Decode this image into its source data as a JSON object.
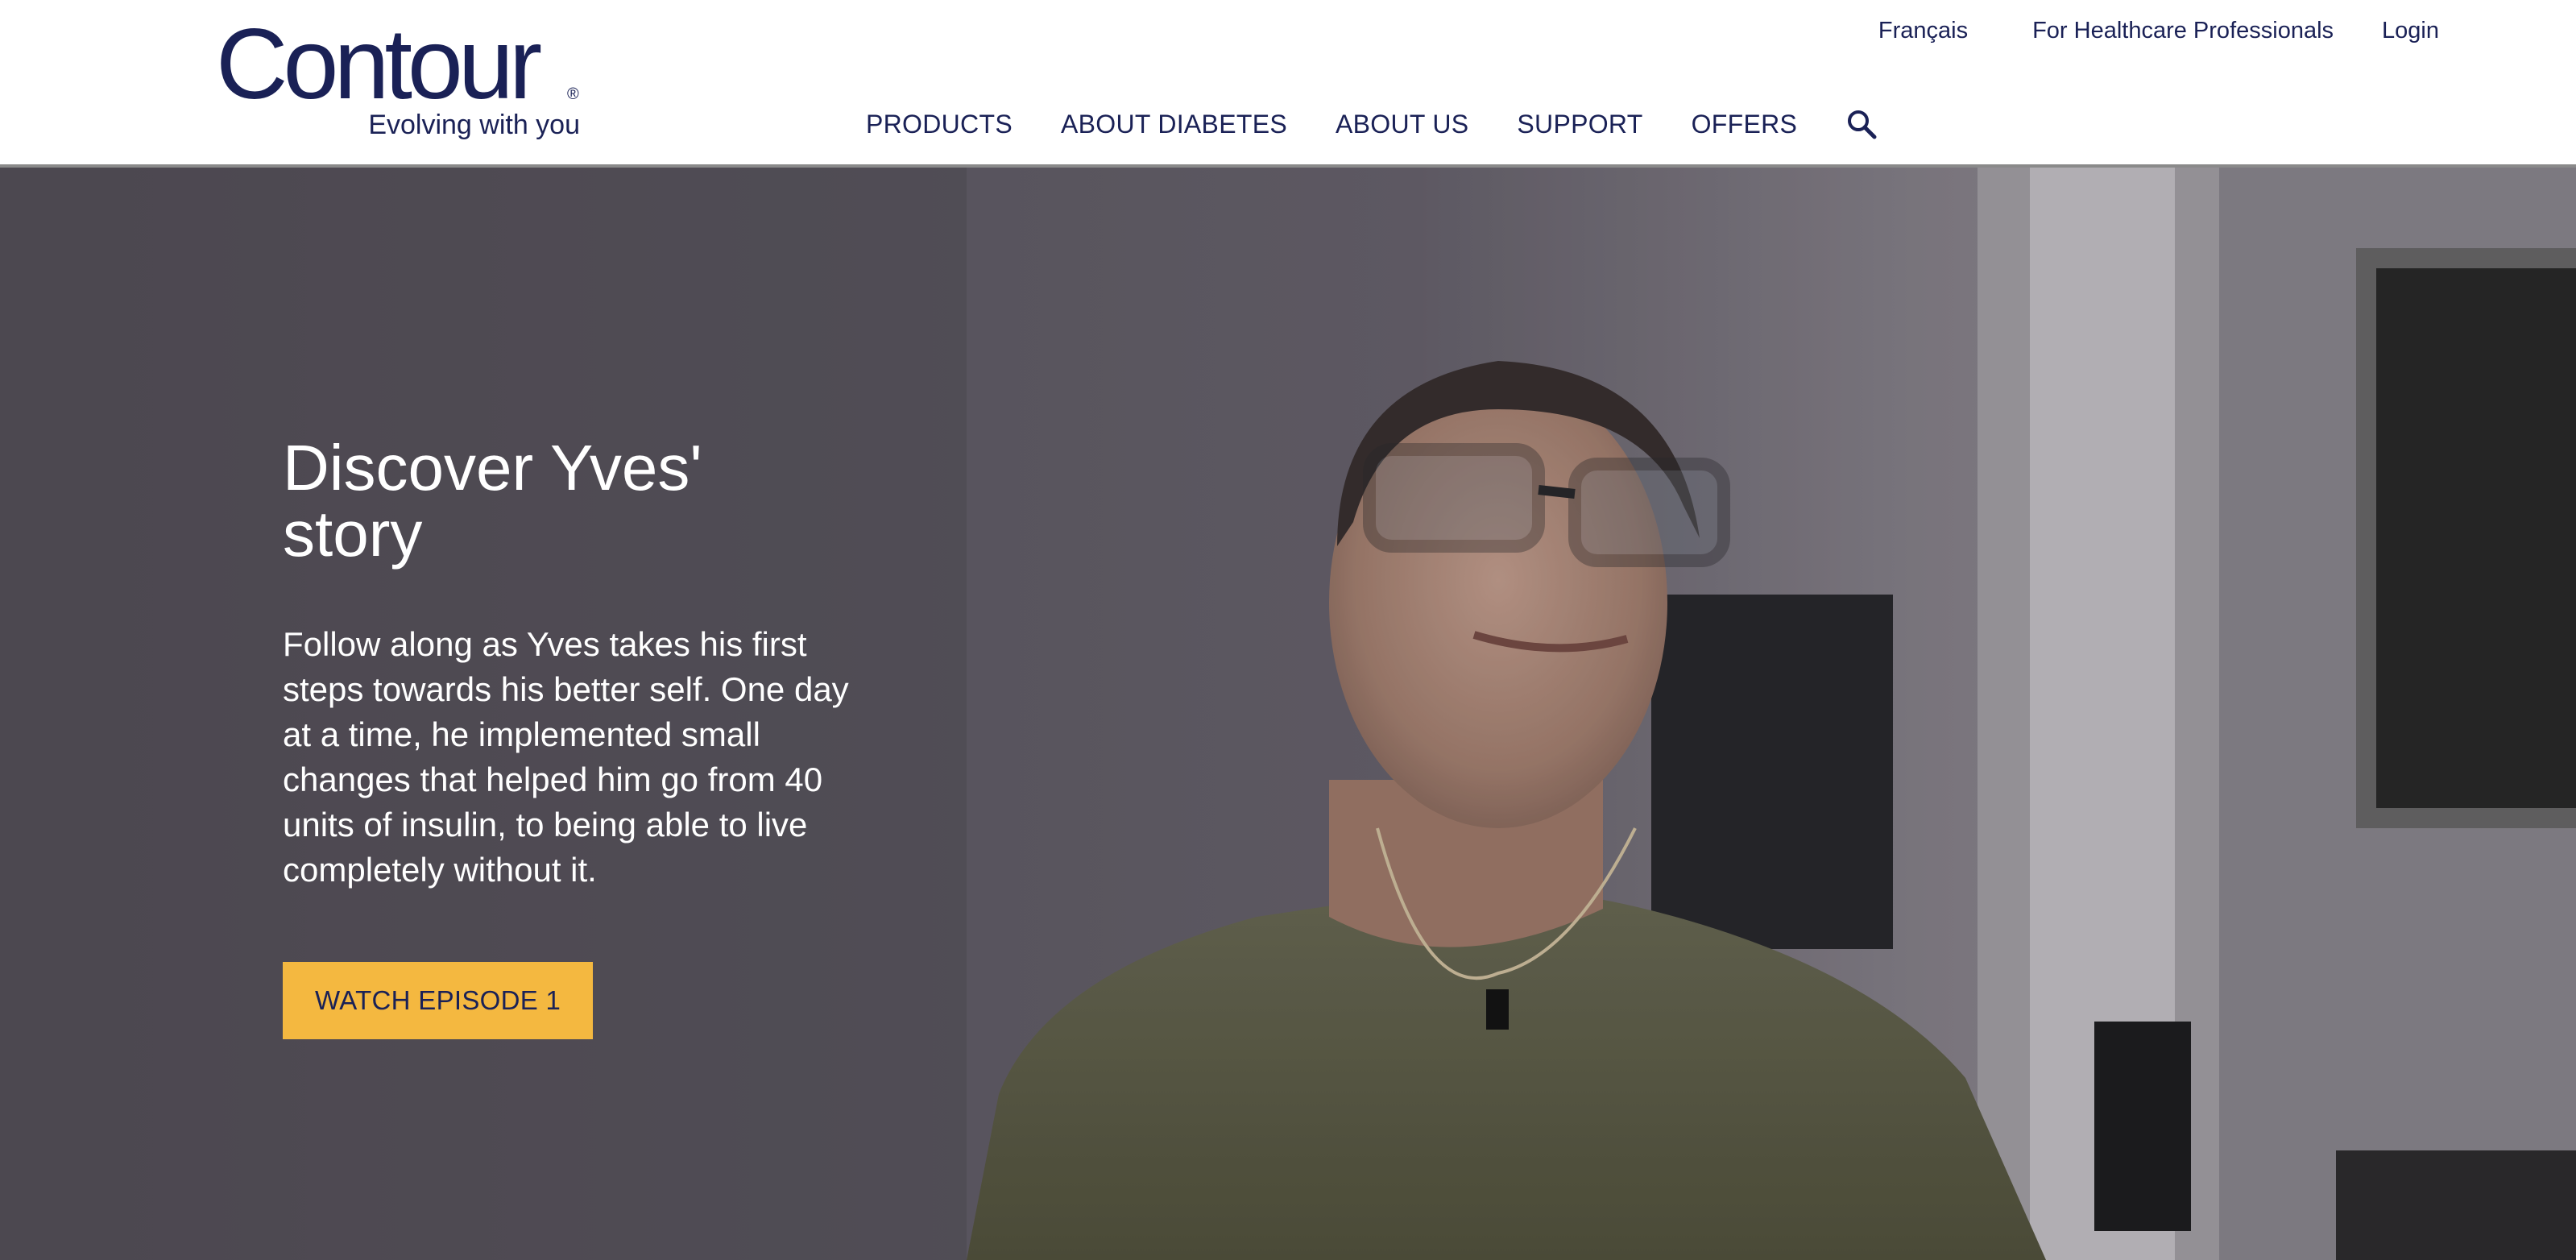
{
  "header": {
    "logo": {
      "wordmark": "Contour",
      "registered": "®",
      "tagline": "Evolving with you"
    },
    "utility_nav": {
      "language": "Français",
      "healthcare": "For Healthcare Professionals",
      "login": "Login"
    },
    "main_nav": {
      "items": [
        "PRODUCTS",
        "ABOUT DIABETES",
        "ABOUT US",
        "SUPPORT",
        "OFFERS"
      ],
      "search_icon": "search-icon"
    }
  },
  "hero": {
    "title": "Discover Yves' story",
    "description": "Follow along as Yves takes his first steps towards his better self. One day at a time, he implemented small changes that helped him go from 40 units of insulin, to being able to live completely without it.",
    "cta_label": "WATCH EPISODE 1"
  },
  "colors": {
    "brand_navy": "#1a2156",
    "cta_yellow": "#f4b840",
    "hero_overlay": "#5e5861"
  }
}
